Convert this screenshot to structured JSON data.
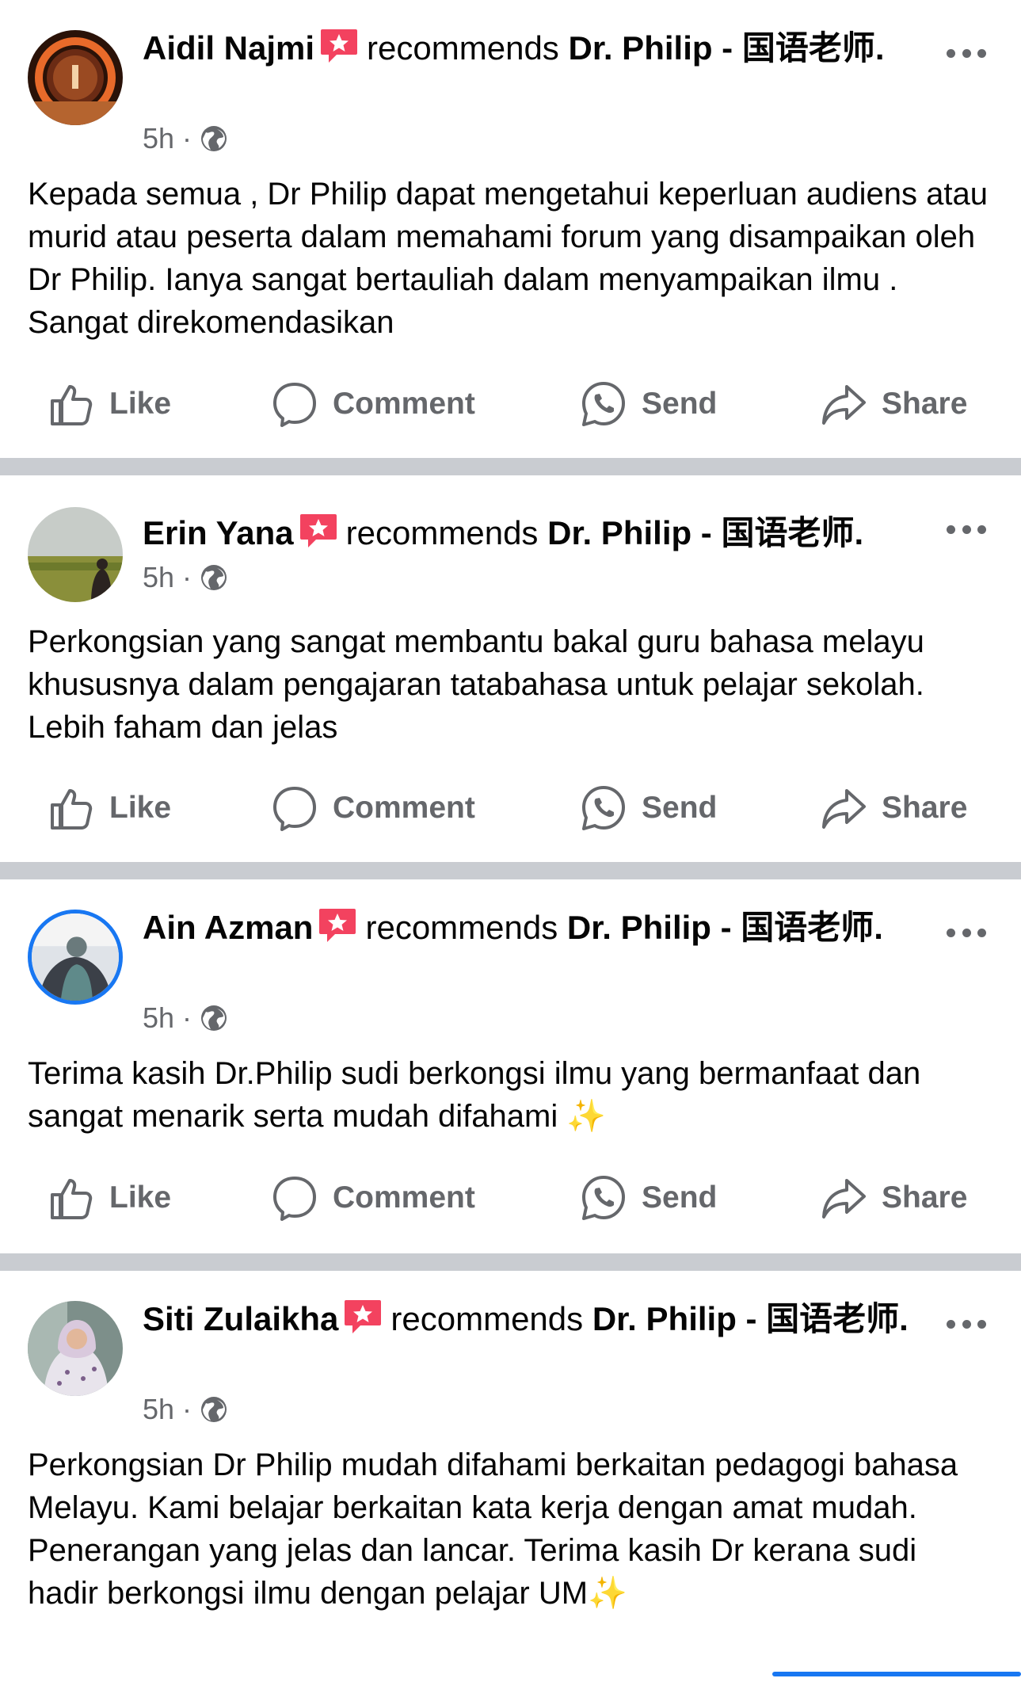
{
  "common": {
    "recommends": "recommends",
    "page_name": "Dr. Philip - 国语老师.",
    "like": "Like",
    "comment": "Comment",
    "send": "Send",
    "share": "Share"
  },
  "posts": [
    {
      "name": "Aidil Najmi",
      "time": "5h",
      "text": "Kepada semua , Dr Philip dapat mengetahui keperluan audiens atau murid atau peserta dalam memahami forum yang disampaikan oleh Dr Philip. Ianya sangat bertauliah dalam menyampaikan ilmu . Sangat direkomendasikan"
    },
    {
      "name": "Erin Yana",
      "time": "5h",
      "text": "Perkongsian yang sangat membantu bakal guru bahasa melayu khususnya dalam pengajaran tatabahasa untuk pelajar sekolah. Lebih faham dan jelas"
    },
    {
      "name": "Ain Azman",
      "time": "5h",
      "text": "Terima kasih Dr.Philip sudi berkongsi ilmu yang bermanfaat dan sangat menarik serta mudah difahami ✨"
    },
    {
      "name": "Siti Zulaikha",
      "time": "5h",
      "text": "Perkongsian Dr Philip mudah difahami berkaitan pedagogi bahasa Melayu. Kami belajar berkaitan kata kerja dengan amat mudah. Penerangan yang jelas dan lancar. Terima kasih Dr kerana sudi hadir berkongsi ilmu dengan pelajar UM✨"
    }
  ],
  "colors": {
    "accent": "#1877f2",
    "muted": "#65676b",
    "divider": "#c9ccd1",
    "recommend_badge": "#f3425f"
  }
}
